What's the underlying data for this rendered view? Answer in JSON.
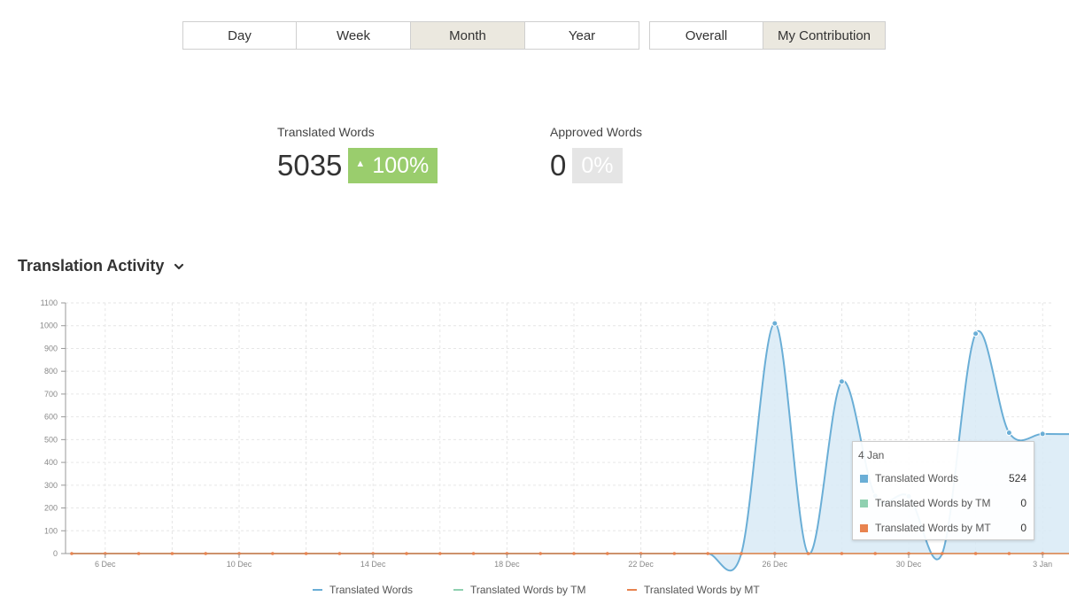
{
  "period_tabs": [
    {
      "label": "Day",
      "active": false
    },
    {
      "label": "Week",
      "active": false
    },
    {
      "label": "Month",
      "active": true
    },
    {
      "label": "Year",
      "active": false
    }
  ],
  "scope_tabs": [
    {
      "label": "Overall",
      "active": false
    },
    {
      "label": "My Contribution",
      "active": true
    }
  ],
  "stats": {
    "translated": {
      "label": "Translated Words",
      "value": "5035",
      "change": "100%",
      "change_icon": "up-triangle-icon"
    },
    "approved": {
      "label": "Approved Words",
      "value": "0",
      "change": "0%"
    }
  },
  "section": {
    "title": "Translation Activity",
    "toggle_icon": "chevron-down-icon"
  },
  "colors": {
    "translated": "#6aaed6",
    "tm": "#8fd0b0",
    "mt": "#e8834f",
    "fill": "#d8eaf6",
    "badge_up": "#9acd6d",
    "badge_neutral": "#e5e5e5"
  },
  "tooltip": {
    "date": "4 Jan",
    "rows": [
      {
        "name": "Translated Words",
        "value": "524",
        "color": "#6aaed6"
      },
      {
        "name": "Translated Words by TM",
        "value": "0",
        "color": "#8fd0b0"
      },
      {
        "name": "Translated Words by MT",
        "value": "0",
        "color": "#e8834f"
      }
    ]
  },
  "chart_data": {
    "type": "area",
    "x": [
      "5 Dec",
      "6 Dec",
      "7 Dec",
      "8 Dec",
      "9 Dec",
      "10 Dec",
      "11 Dec",
      "12 Dec",
      "13 Dec",
      "14 Dec",
      "15 Dec",
      "16 Dec",
      "17 Dec",
      "18 Dec",
      "19 Dec",
      "20 Dec",
      "21 Dec",
      "22 Dec",
      "23 Dec",
      "24 Dec",
      "25 Dec",
      "26 Dec",
      "27 Dec",
      "28 Dec",
      "29 Dec",
      "30 Dec",
      "31 Dec",
      "1 Jan",
      "2 Jan",
      "3 Jan",
      "4 Jan"
    ],
    "x_tick_labels": [
      "6 Dec",
      "10 Dec",
      "14 Dec",
      "18 Dec",
      "22 Dec",
      "26 Dec",
      "30 Dec",
      "3 Jan"
    ],
    "series": [
      {
        "name": "Translated Words",
        "values": [
          0,
          0,
          0,
          0,
          0,
          0,
          0,
          0,
          0,
          0,
          0,
          0,
          0,
          0,
          0,
          0,
          0,
          0,
          0,
          0,
          0,
          1010,
          0,
          755,
          253,
          251,
          0,
          965,
          530,
          525,
          524
        ]
      },
      {
        "name": "Translated Words by TM",
        "values": [
          0,
          0,
          0,
          0,
          0,
          0,
          0,
          0,
          0,
          0,
          0,
          0,
          0,
          0,
          0,
          0,
          0,
          0,
          0,
          0,
          0,
          0,
          0,
          0,
          0,
          0,
          0,
          0,
          0,
          0,
          0
        ]
      },
      {
        "name": "Translated Words by MT",
        "values": [
          0,
          0,
          0,
          0,
          0,
          0,
          0,
          0,
          0,
          0,
          0,
          0,
          0,
          0,
          0,
          0,
          0,
          0,
          0,
          0,
          0,
          0,
          0,
          0,
          0,
          0,
          0,
          0,
          0,
          0,
          0
        ]
      }
    ],
    "y_ticks": [
      0,
      100,
      200,
      300,
      400,
      500,
      600,
      700,
      800,
      900,
      1000,
      1100
    ],
    "ylim": [
      0,
      1100
    ],
    "grid": true,
    "legend_position": "bottom"
  }
}
